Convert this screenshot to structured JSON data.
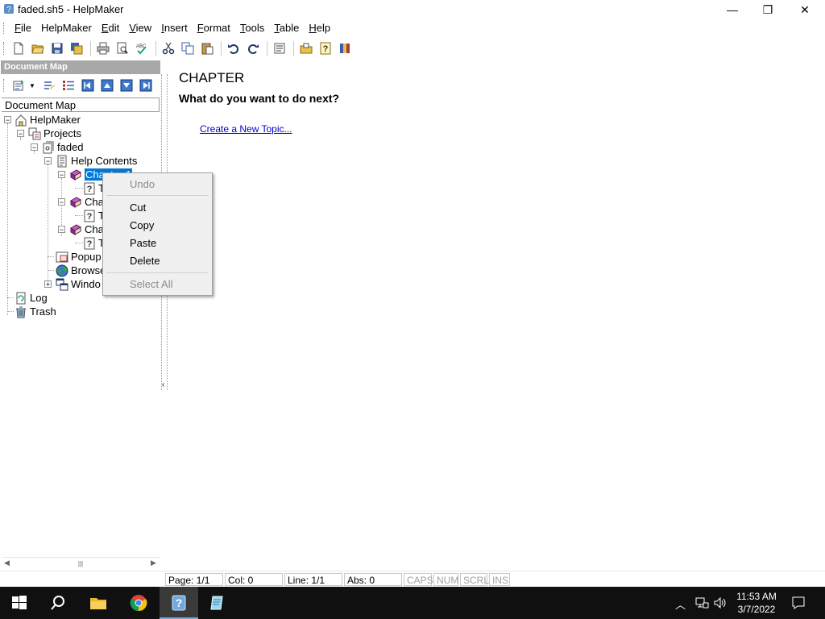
{
  "window": {
    "title": "faded.sh5 - HelpMaker",
    "controls": {
      "minimize": "—",
      "restore": "❐",
      "close": "✕"
    }
  },
  "menu": [
    {
      "label": "File",
      "key": "F"
    },
    {
      "label": "HelpMaker",
      "key": ""
    },
    {
      "label": "Edit",
      "key": "E"
    },
    {
      "label": "View",
      "key": "V"
    },
    {
      "label": "Insert",
      "key": "I"
    },
    {
      "label": "Format",
      "key": "F"
    },
    {
      "label": "Tools",
      "key": "T"
    },
    {
      "label": "Table",
      "key": "T"
    },
    {
      "label": "Help",
      "key": "H"
    }
  ],
  "docmap": {
    "header": "Document Map",
    "label": "Document Map"
  },
  "tree": {
    "root": "HelpMaker",
    "projects": "Projects",
    "project": "faded",
    "help_contents": "Help Contents",
    "chapter1": "Chapter 1",
    "chapter2": "Cha",
    "chapter3": "Cha",
    "topic": "T",
    "popup": "Popup",
    "browse": "Browse",
    "window": "Windo",
    "log": "Log",
    "trash": "Trash"
  },
  "content": {
    "title": "CHAPTER",
    "question": "What do you want to do next?",
    "link": "Create a New Topic..."
  },
  "context_menu": {
    "undo": "Undo",
    "cut": "Cut",
    "copy": "Copy",
    "paste": "Paste",
    "delete": "Delete",
    "select_all": "Select All"
  },
  "status": {
    "page": "Page: 1/1",
    "col": "Col: 0",
    "line": "Line: 1/1",
    "abs": "Abs: 0",
    "caps": "CAPS",
    "num": "NUM",
    "scrl": "SCRL",
    "ins": "INS"
  },
  "clock": {
    "time": "11:53 AM",
    "date": "3/7/2022"
  },
  "colors": {
    "selection": "#0078d7",
    "link": "#0000cc",
    "taskbar": "#101010"
  }
}
